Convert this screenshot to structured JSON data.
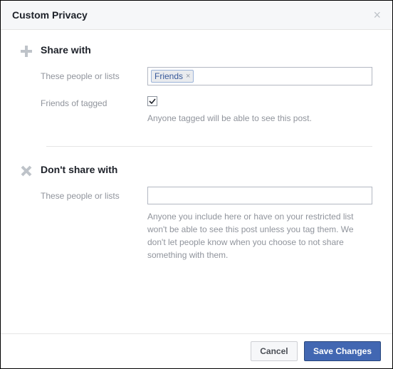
{
  "dialog": {
    "title": "Custom Privacy"
  },
  "share_with": {
    "heading": "Share with",
    "people_label": "These people or lists",
    "tokens": [
      "Friends"
    ],
    "friends_of_tagged_label": "Friends of tagged",
    "friends_of_tagged_checked": true,
    "help": "Anyone tagged will be able to see this post."
  },
  "dont_share_with": {
    "heading": "Don't share with",
    "people_label": "These people or lists",
    "help": "Anyone you include here or have on your restricted list won't be able to see this post unless you tag them. We don't let people know when you choose to not share something with them."
  },
  "footer": {
    "cancel": "Cancel",
    "save": "Save Changes"
  }
}
